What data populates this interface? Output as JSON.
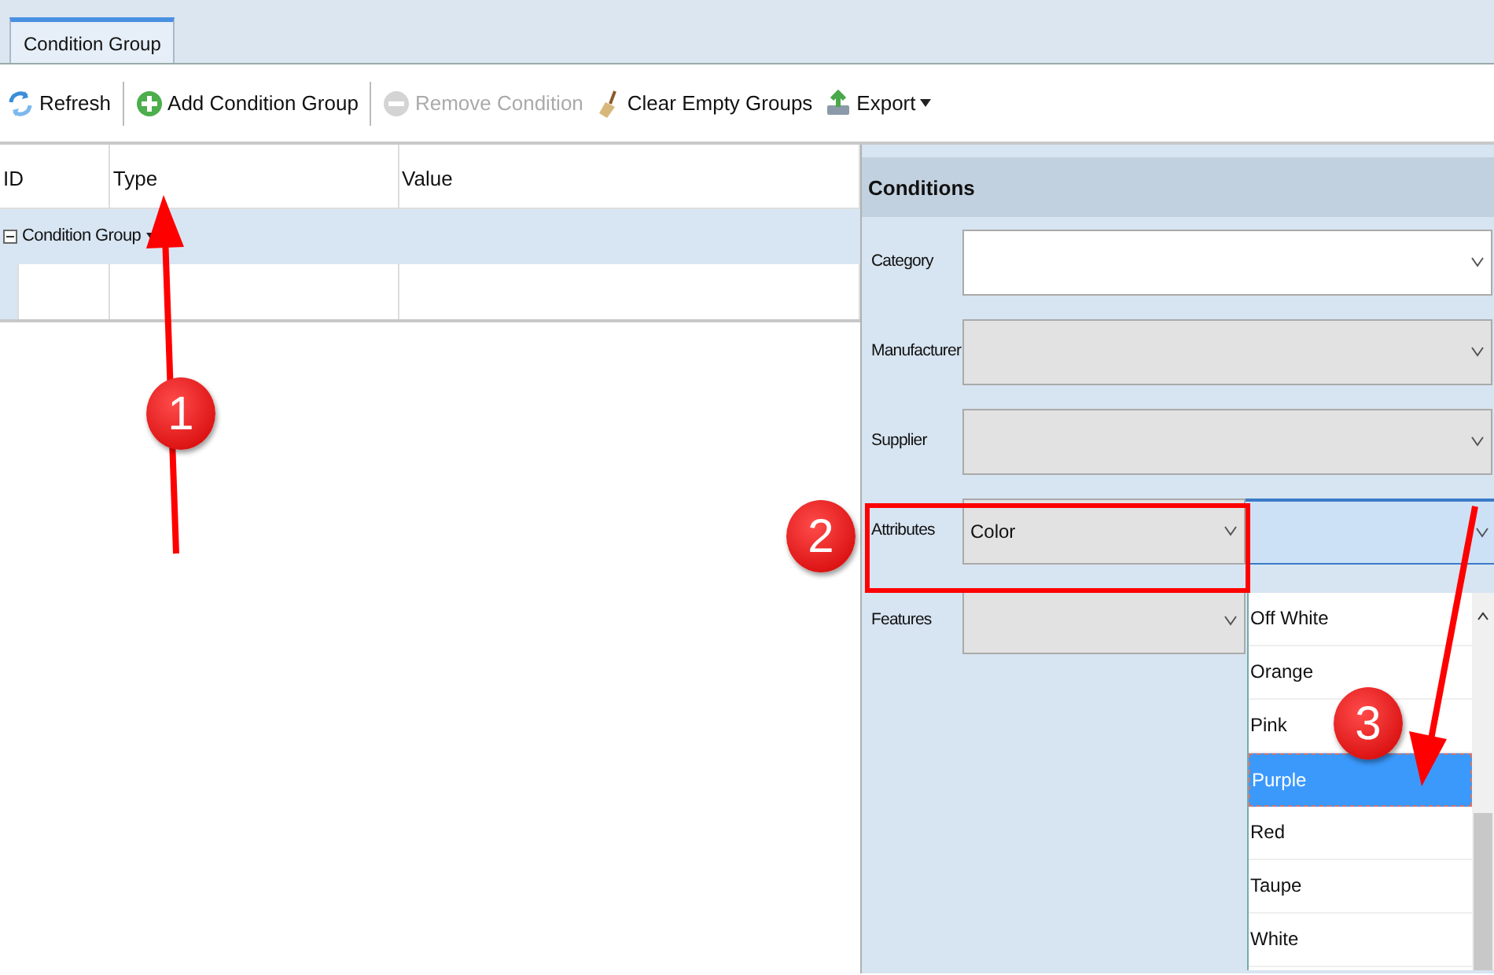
{
  "tabs": [
    {
      "label": "Condition Group",
      "selected": true
    }
  ],
  "toolbar": [
    {
      "label": "Refresh",
      "disabled": false,
      "separator_after": true
    },
    {
      "label": "Add Condition Group",
      "disabled": false,
      "separator_after": true
    },
    {
      "label": "Remove Condition",
      "disabled": true,
      "separator_after": false
    },
    {
      "label": "Clear Empty Groups",
      "disabled": false,
      "separator_after": false
    },
    {
      "label": "Export",
      "disabled": false,
      "separator_after": false,
      "dropdown": true
    }
  ],
  "grid": {
    "columns": [
      "ID",
      "Type",
      "Value"
    ],
    "group_row": {
      "label": "Condition Group",
      "expanded": true
    }
  },
  "conditions": {
    "title": "Conditions",
    "fields": [
      {
        "label": "Category",
        "enabled": true
      },
      {
        "label": "Manufacturer",
        "enabled": false
      },
      {
        "label": "Supplier",
        "enabled": false
      },
      {
        "label": "Attributes",
        "enabled": false,
        "value": "Color",
        "second_combo": true
      },
      {
        "label": "Features",
        "enabled": false
      }
    ],
    "dropdown": [
      {
        "label": "Off White",
        "selected": false
      },
      {
        "label": "Orange",
        "selected": false
      },
      {
        "label": "Pink",
        "selected": false
      },
      {
        "label": "Purple",
        "selected": true
      },
      {
        "label": "Red",
        "selected": false
      },
      {
        "label": "Taupe",
        "selected": false
      },
      {
        "label": "White",
        "selected": false
      }
    ]
  },
  "callouts": [
    {
      "label": "1"
    },
    {
      "label": "2"
    },
    {
      "label": "3"
    }
  ]
}
